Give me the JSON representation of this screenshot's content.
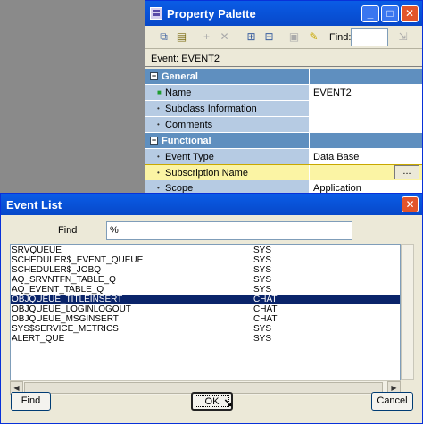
{
  "property_palette": {
    "title": "Property Palette",
    "toolbar": {
      "find_label": "Find:",
      "find_value": ""
    },
    "object_line": "Event: EVENT2",
    "rows": [
      {
        "type": "section",
        "label": "General",
        "value": ""
      },
      {
        "type": "prop",
        "label": "Name",
        "value": "EVENT2",
        "bullet": "green"
      },
      {
        "type": "prop",
        "label": "Subclass Information",
        "value": ""
      },
      {
        "type": "prop",
        "label": "Comments",
        "value": ""
      },
      {
        "type": "section",
        "label": "Functional",
        "value": ""
      },
      {
        "type": "prop",
        "label": "Event Type",
        "value": "Data Base"
      },
      {
        "type": "prop",
        "label": "Subscription Name",
        "value": "",
        "highlight": true,
        "browse_label": "..."
      },
      {
        "type": "prop",
        "label": "Scope",
        "value": "Application"
      }
    ]
  },
  "event_list": {
    "title": "Event List",
    "find_label": "Find",
    "find_value": "%",
    "items": [
      {
        "name": "SRVQUEUE",
        "owner": "SYS"
      },
      {
        "name": "SCHEDULER$_EVENT_QUEUE",
        "owner": "SYS"
      },
      {
        "name": "SCHEDULER$_JOBQ",
        "owner": "SYS"
      },
      {
        "name": "AQ_SRVNTFN_TABLE_Q",
        "owner": "SYS"
      },
      {
        "name": "AQ_EVENT_TABLE_Q",
        "owner": "SYS"
      },
      {
        "name": "OBJQUEUE_TITLEINSERT",
        "owner": "CHAT",
        "selected": true
      },
      {
        "name": "OBJQUEUE_LOGINLOGOUT",
        "owner": "CHAT"
      },
      {
        "name": "OBJQUEUE_MSGINSERT",
        "owner": "CHAT"
      },
      {
        "name": "SYS$SERVICE_METRICS",
        "owner": "SYS"
      },
      {
        "name": "ALERT_QUE",
        "owner": "SYS"
      }
    ],
    "buttons": {
      "find": "Find",
      "ok": "OK",
      "cancel": "Cancel"
    }
  },
  "colors": {
    "titlebar": "#0748c9",
    "selection": "#0a246a",
    "section": "#5f8fbf",
    "property": "#b6cbe3",
    "highlight": "#fbf4a4"
  }
}
